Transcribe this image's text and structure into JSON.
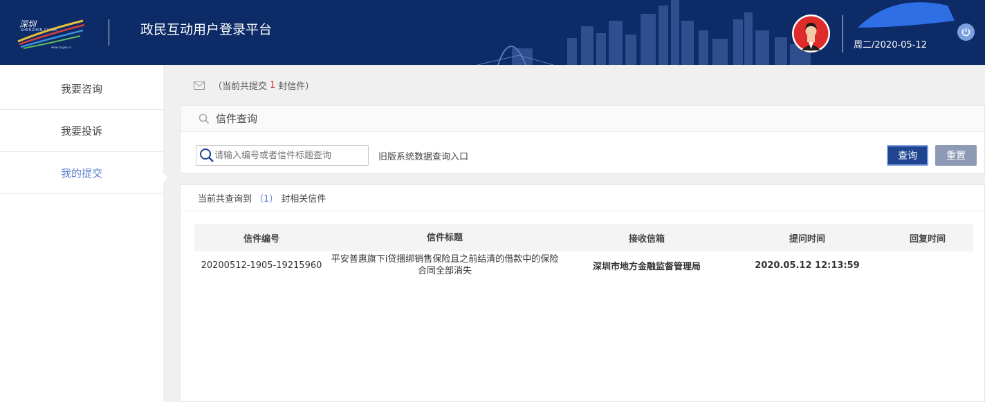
{
  "header": {
    "logo_cn": "深圳",
    "logo_sub": "SHENZHEN CHINA",
    "logo_url": "www.sz.gov.cn",
    "title": "政民互动用户登录平台",
    "date": "周二/2020-05-12"
  },
  "sidebar": {
    "items": [
      {
        "label": "我要咨询"
      },
      {
        "label": "我要投诉"
      },
      {
        "label": "我的提交"
      }
    ]
  },
  "summary": {
    "prefix": "（当前共提交",
    "count": "1",
    "suffix": "封信件）"
  },
  "query": {
    "title": "信件查询",
    "search_placeholder": "请输入编号或者信件标题查询",
    "old_link": "旧版系统数据查询入口",
    "query_button": "查询",
    "reset_button": "重置"
  },
  "results": {
    "prefix": "当前共查询到",
    "count": "（1）",
    "suffix": "封相关信件",
    "columns": [
      "信件编号",
      "信件标题",
      "接收信箱",
      "提问时间",
      "回复时间"
    ],
    "rows": [
      {
        "id": "20200512-1905-19215960",
        "title": "平安普惠旗下i贷捆绑销售保险且之前结清的借款中的保险合同全部消失",
        "mailbox": "深圳市地方金融监督管理局",
        "asked": "2020.05.12 12:13:59",
        "replied": ""
      }
    ]
  },
  "colors": {
    "header_bg": "#0d2b66",
    "accent": "#5b7fd1",
    "query_button": "#1f4591",
    "reset_button": "#8e9ab5",
    "count_red": "#d4302d"
  }
}
